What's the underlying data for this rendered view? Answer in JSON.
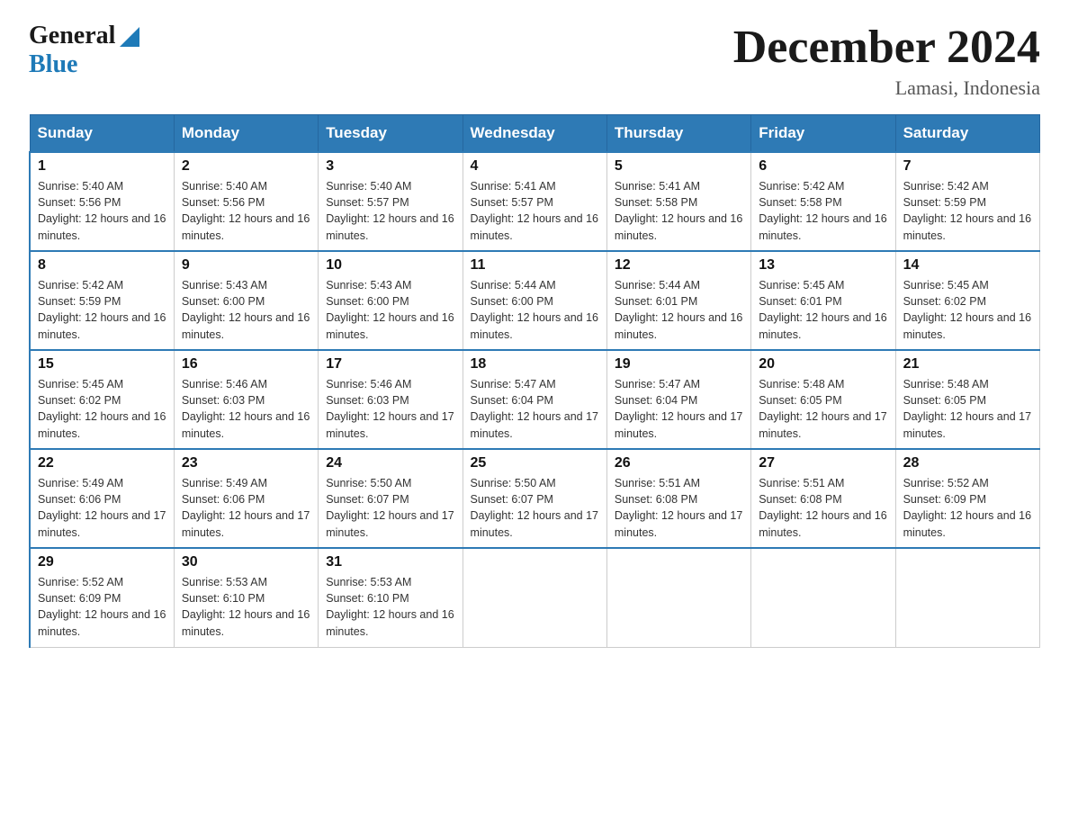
{
  "header": {
    "logo_general": "General",
    "logo_blue": "Blue",
    "month_title": "December 2024",
    "location": "Lamasi, Indonesia"
  },
  "days_of_week": [
    "Sunday",
    "Monday",
    "Tuesday",
    "Wednesday",
    "Thursday",
    "Friday",
    "Saturday"
  ],
  "weeks": [
    [
      {
        "day": "1",
        "sunrise": "5:40 AM",
        "sunset": "5:56 PM",
        "daylight": "12 hours and 16 minutes."
      },
      {
        "day": "2",
        "sunrise": "5:40 AM",
        "sunset": "5:56 PM",
        "daylight": "12 hours and 16 minutes."
      },
      {
        "day": "3",
        "sunrise": "5:40 AM",
        "sunset": "5:57 PM",
        "daylight": "12 hours and 16 minutes."
      },
      {
        "day": "4",
        "sunrise": "5:41 AM",
        "sunset": "5:57 PM",
        "daylight": "12 hours and 16 minutes."
      },
      {
        "day": "5",
        "sunrise": "5:41 AM",
        "sunset": "5:58 PM",
        "daylight": "12 hours and 16 minutes."
      },
      {
        "day": "6",
        "sunrise": "5:42 AM",
        "sunset": "5:58 PM",
        "daylight": "12 hours and 16 minutes."
      },
      {
        "day": "7",
        "sunrise": "5:42 AM",
        "sunset": "5:59 PM",
        "daylight": "12 hours and 16 minutes."
      }
    ],
    [
      {
        "day": "8",
        "sunrise": "5:42 AM",
        "sunset": "5:59 PM",
        "daylight": "12 hours and 16 minutes."
      },
      {
        "day": "9",
        "sunrise": "5:43 AM",
        "sunset": "6:00 PM",
        "daylight": "12 hours and 16 minutes."
      },
      {
        "day": "10",
        "sunrise": "5:43 AM",
        "sunset": "6:00 PM",
        "daylight": "12 hours and 16 minutes."
      },
      {
        "day": "11",
        "sunrise": "5:44 AM",
        "sunset": "6:00 PM",
        "daylight": "12 hours and 16 minutes."
      },
      {
        "day": "12",
        "sunrise": "5:44 AM",
        "sunset": "6:01 PM",
        "daylight": "12 hours and 16 minutes."
      },
      {
        "day": "13",
        "sunrise": "5:45 AM",
        "sunset": "6:01 PM",
        "daylight": "12 hours and 16 minutes."
      },
      {
        "day": "14",
        "sunrise": "5:45 AM",
        "sunset": "6:02 PM",
        "daylight": "12 hours and 16 minutes."
      }
    ],
    [
      {
        "day": "15",
        "sunrise": "5:45 AM",
        "sunset": "6:02 PM",
        "daylight": "12 hours and 16 minutes."
      },
      {
        "day": "16",
        "sunrise": "5:46 AM",
        "sunset": "6:03 PM",
        "daylight": "12 hours and 16 minutes."
      },
      {
        "day": "17",
        "sunrise": "5:46 AM",
        "sunset": "6:03 PM",
        "daylight": "12 hours and 17 minutes."
      },
      {
        "day": "18",
        "sunrise": "5:47 AM",
        "sunset": "6:04 PM",
        "daylight": "12 hours and 17 minutes."
      },
      {
        "day": "19",
        "sunrise": "5:47 AM",
        "sunset": "6:04 PM",
        "daylight": "12 hours and 17 minutes."
      },
      {
        "day": "20",
        "sunrise": "5:48 AM",
        "sunset": "6:05 PM",
        "daylight": "12 hours and 17 minutes."
      },
      {
        "day": "21",
        "sunrise": "5:48 AM",
        "sunset": "6:05 PM",
        "daylight": "12 hours and 17 minutes."
      }
    ],
    [
      {
        "day": "22",
        "sunrise": "5:49 AM",
        "sunset": "6:06 PM",
        "daylight": "12 hours and 17 minutes."
      },
      {
        "day": "23",
        "sunrise": "5:49 AM",
        "sunset": "6:06 PM",
        "daylight": "12 hours and 17 minutes."
      },
      {
        "day": "24",
        "sunrise": "5:50 AM",
        "sunset": "6:07 PM",
        "daylight": "12 hours and 17 minutes."
      },
      {
        "day": "25",
        "sunrise": "5:50 AM",
        "sunset": "6:07 PM",
        "daylight": "12 hours and 17 minutes."
      },
      {
        "day": "26",
        "sunrise": "5:51 AM",
        "sunset": "6:08 PM",
        "daylight": "12 hours and 17 minutes."
      },
      {
        "day": "27",
        "sunrise": "5:51 AM",
        "sunset": "6:08 PM",
        "daylight": "12 hours and 16 minutes."
      },
      {
        "day": "28",
        "sunrise": "5:52 AM",
        "sunset": "6:09 PM",
        "daylight": "12 hours and 16 minutes."
      }
    ],
    [
      {
        "day": "29",
        "sunrise": "5:52 AM",
        "sunset": "6:09 PM",
        "daylight": "12 hours and 16 minutes."
      },
      {
        "day": "30",
        "sunrise": "5:53 AM",
        "sunset": "6:10 PM",
        "daylight": "12 hours and 16 minutes."
      },
      {
        "day": "31",
        "sunrise": "5:53 AM",
        "sunset": "6:10 PM",
        "daylight": "12 hours and 16 minutes."
      },
      null,
      null,
      null,
      null
    ]
  ]
}
